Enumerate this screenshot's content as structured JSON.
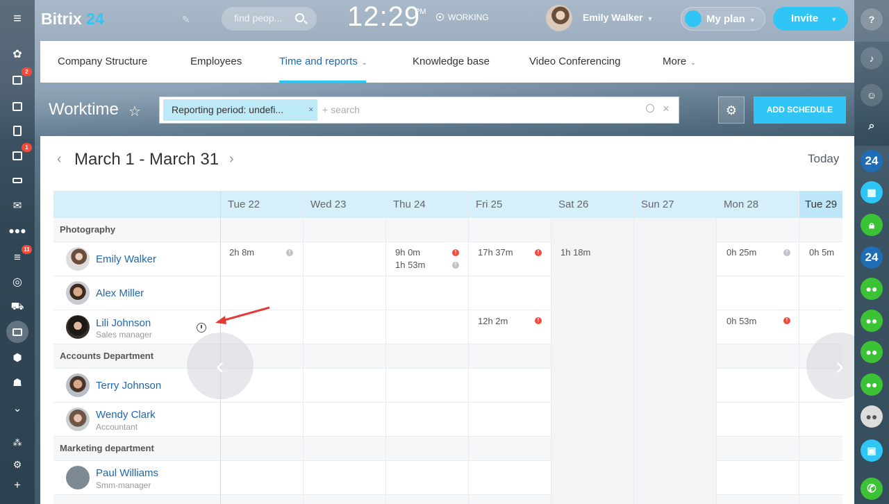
{
  "header": {
    "logo_main": "Bitrix",
    "logo_num": "24",
    "search_placeholder": "find peop...",
    "time": "12:29",
    "ampm": "PM",
    "status": "WORKING",
    "user": "Emily Walker",
    "plan": "My plan",
    "invite": "Invite"
  },
  "left_sidebar": {
    "badges": {
      "tasks": "2",
      "checklist": "1",
      "filters": "11"
    }
  },
  "nav": {
    "items": [
      "Company Structure",
      "Employees",
      "Time and reports",
      "Knowledge base",
      "Video Conferencing",
      "More"
    ]
  },
  "toolbar": {
    "title": "Worktime",
    "filter_chip": "Reporting period: undefi...",
    "filter_search": "+ search",
    "add_schedule": "ADD SCHEDULE"
  },
  "calendar": {
    "range": "March 1 - March 31",
    "today": "Today",
    "days": [
      "Tue 22",
      "Wed 23",
      "Thu 24",
      "Fri 25",
      "Sat 26",
      "Sun 27",
      "Mon 28",
      "Tue 29"
    ]
  },
  "sections": [
    {
      "name": "Photography",
      "employees": [
        {
          "name": "Emily Walker",
          "role": "",
          "cells": {
            "Tue 22": [
              "2h 8m"
            ],
            "Thu 24": [
              "9h 0m",
              "1h 53m"
            ],
            "Fri 25": [
              "17h 37m"
            ],
            "Sat 26": [
              "1h 18m"
            ],
            "Mon 28": [
              "0h 25m"
            ],
            "Tue 29": [
              "0h 5m"
            ]
          }
        },
        {
          "name": "Alex Miller",
          "role": ""
        },
        {
          "name": "Lili Johnson",
          "role": "Sales manager",
          "cells": {
            "Fri 25": [
              "12h 2m"
            ],
            "Mon 28": [
              "0h 53m"
            ]
          }
        }
      ]
    },
    {
      "name": "Accounts Department",
      "employees": [
        {
          "name": "Terry Johnson",
          "role": ""
        },
        {
          "name": "Wendy Clark",
          "role": "Accountant"
        }
      ]
    },
    {
      "name": "Marketing department",
      "employees": [
        {
          "name": "Paul Williams",
          "role": "Smm-manager"
        }
      ]
    }
  ],
  "right_sidebar": {
    "brand_label": "24"
  },
  "colors": {
    "accent": "#2fc6f6",
    "link": "#2067b0",
    "alert": "#f5493b"
  }
}
